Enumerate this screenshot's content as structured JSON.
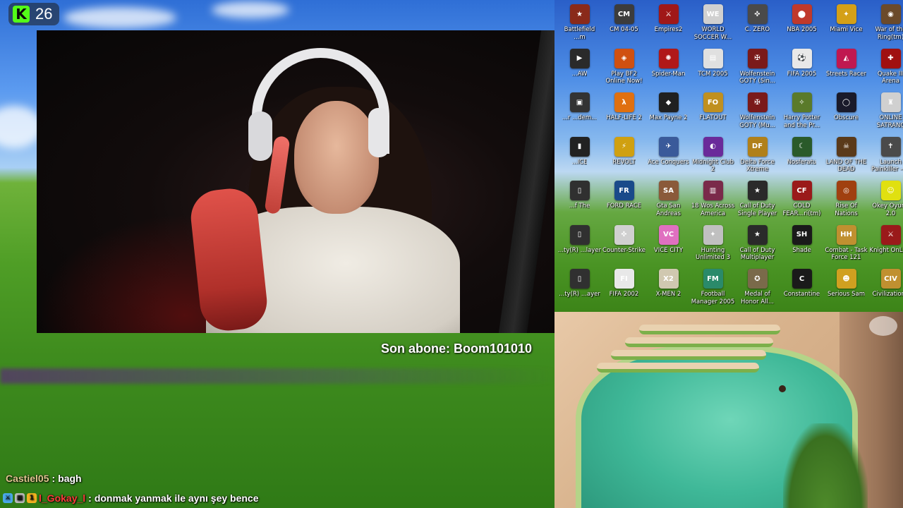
{
  "viewer_badge": {
    "count": "26",
    "logo_letter": "K",
    "logo_color": "#53fc18"
  },
  "overlay": {
    "last_subscriber": "Son abone: Boom101010"
  },
  "desktop": {
    "icons": [
      {
        "label": "Battlefield ...m",
        "glyph": "★",
        "color": "#8a2a1a"
      },
      {
        "label": "CM 04-05",
        "glyph": "CM",
        "color": "#3c3c3c"
      },
      {
        "label": "Empires2",
        "glyph": "⚔",
        "color": "#a01818"
      },
      {
        "label": "WORLD SOCCER W...",
        "glyph": "WE",
        "color": "#d0d0d0"
      },
      {
        "label": "C. ZERO",
        "glyph": "✜",
        "color": "#4a4a4a"
      },
      {
        "label": "NBA 2005",
        "glyph": "⬤",
        "color": "#c0392b"
      },
      {
        "label": "Miami Vice",
        "glyph": "✦",
        "color": "#d4a017"
      },
      {
        "label": "War of the Ring(tm)",
        "glyph": "◉",
        "color": "#6b4a2a"
      },
      {
        "label": "...AW",
        "glyph": "▶",
        "color": "#2a2a2a"
      },
      {
        "label": "Play BF2 Online Now!",
        "glyph": "◈",
        "color": "#d05010"
      },
      {
        "label": "Spider-Man",
        "glyph": "✺",
        "color": "#b01818"
      },
      {
        "label": "TCM 2005",
        "glyph": "▤",
        "color": "#e0e0e0"
      },
      {
        "label": "Wolfenstein GOTY (Sin...",
        "glyph": "✠",
        "color": "#7a1a1a"
      },
      {
        "label": "FIFA 2005",
        "glyph": "⚽",
        "color": "#e8e8e8"
      },
      {
        "label": "Streets Racer",
        "glyph": "◭",
        "color": "#c01850"
      },
      {
        "label": "Quake III Arena",
        "glyph": "✚",
        "color": "#a01010"
      },
      {
        "label": "...r ...dem...",
        "glyph": "▣",
        "color": "#333333"
      },
      {
        "label": "HALF-LIFE 2",
        "glyph": "λ",
        "color": "#e07010"
      },
      {
        "label": "Max Payne 2",
        "glyph": "◆",
        "color": "#202020"
      },
      {
        "label": "FLATOUT",
        "glyph": "FO",
        "color": "#c09020"
      },
      {
        "label": "Wolfenstein GOTY (Mu...",
        "glyph": "✠",
        "color": "#7a1a1a"
      },
      {
        "label": "Harry Potter and the Pr...",
        "glyph": "✧",
        "color": "#5a7a2a"
      },
      {
        "label": "Obscure",
        "glyph": "◯",
        "color": "#1a1a2a"
      },
      {
        "label": "ONLINE SATRANÇ",
        "glyph": "♜",
        "color": "#d0d0d0"
      },
      {
        "label": "...ICE",
        "glyph": "▮",
        "color": "#222222"
      },
      {
        "label": "REVOLT",
        "glyph": "⚡",
        "color": "#d0a010"
      },
      {
        "label": "Ace Conquers",
        "glyph": "✈",
        "color": "#3a5a9a"
      },
      {
        "label": "Midnight Club 2",
        "glyph": "◐",
        "color": "#6a2a9a"
      },
      {
        "label": "Delta Force Xtreme",
        "glyph": "DF",
        "color": "#b0801a"
      },
      {
        "label": "Nosferatu",
        "glyph": "☾",
        "color": "#2a5a2a"
      },
      {
        "label": "LAND OF THE DEAD",
        "glyph": "☠",
        "color": "#5a3a1a"
      },
      {
        "label": "Launch Painkiller - ...",
        "glyph": "✝",
        "color": "#4a4a4a"
      },
      {
        "label": "...f The",
        "glyph": "▯",
        "color": "#303030"
      },
      {
        "label": "FORD RACE",
        "glyph": "FR",
        "color": "#1a4a8a"
      },
      {
        "label": "Gta San Andreas",
        "glyph": "SA",
        "color": "#8a5a3a"
      },
      {
        "label": "18 Wos Across America",
        "glyph": "▥",
        "color": "#7a2a4a"
      },
      {
        "label": "Call of Duty Single Player",
        "glyph": "★",
        "color": "#2a2a2a"
      },
      {
        "label": "COLD FEAR...ri(tm)",
        "glyph": "CF",
        "color": "#9a1a1a"
      },
      {
        "label": "Rise Of Nations",
        "glyph": "◎",
        "color": "#a04010"
      },
      {
        "label": "Okey Oyunu 2.0",
        "glyph": "☺",
        "color": "#e0e010"
      },
      {
        "label": "...ty(R) ...layer",
        "glyph": "▯",
        "color": "#303030"
      },
      {
        "label": "Counter-Strike",
        "glyph": "✜",
        "color": "#d0d0d0"
      },
      {
        "label": "VICE CITY",
        "glyph": "VC",
        "color": "#e070c0"
      },
      {
        "label": "Hunting Unlimited 3",
        "glyph": "✦",
        "color": "#c0c0c0"
      },
      {
        "label": "Call of Duty Multiplayer",
        "glyph": "★",
        "color": "#2a2a2a"
      },
      {
        "label": "Shade",
        "glyph": "SH",
        "color": "#1a1a1a"
      },
      {
        "label": "Combat - Task Force 121",
        "glyph": "HH",
        "color": "#c09030"
      },
      {
        "label": "Knight OnLine",
        "glyph": "⚔",
        "color": "#9a1a1a"
      },
      {
        "label": "...ty(R) ...ayer",
        "glyph": "▯",
        "color": "#303030"
      },
      {
        "label": "FIFA 2002",
        "glyph": "FI",
        "color": "#e8e8e8"
      },
      {
        "label": "X-MEN 2",
        "glyph": "X2",
        "color": "#d0c8b0"
      },
      {
        "label": "Football Manager 2005",
        "glyph": "FM",
        "color": "#2a8a6a"
      },
      {
        "label": "Medal of Honor All...",
        "glyph": "✪",
        "color": "#7a6a4a"
      },
      {
        "label": "Constantine",
        "glyph": "C",
        "color": "#1a1a1a"
      },
      {
        "label": "Serious Sam",
        "glyph": "☻",
        "color": "#d0a020"
      },
      {
        "label": "Civilization4",
        "glyph": "CIV",
        "color": "#c09030"
      }
    ]
  },
  "chat": {
    "messages": [
      {
        "user": "Castiel05",
        "separator": ":",
        "text": "bagh",
        "badges": []
      },
      {
        "user": "l_Gokay_l",
        "separator": ":",
        "text": "donmak yanmak ile aynı şey bence",
        "badges": [
          {
            "icon": "moderator-icon",
            "glyph": "⚔",
            "color": "#4aa8e8"
          },
          {
            "icon": "subscriber-icon",
            "glyph": "▦",
            "color": "#bbbbbb"
          },
          {
            "icon": "gifter-icon",
            "glyph": "1",
            "color": "#f0b020"
          }
        ]
      }
    ]
  }
}
